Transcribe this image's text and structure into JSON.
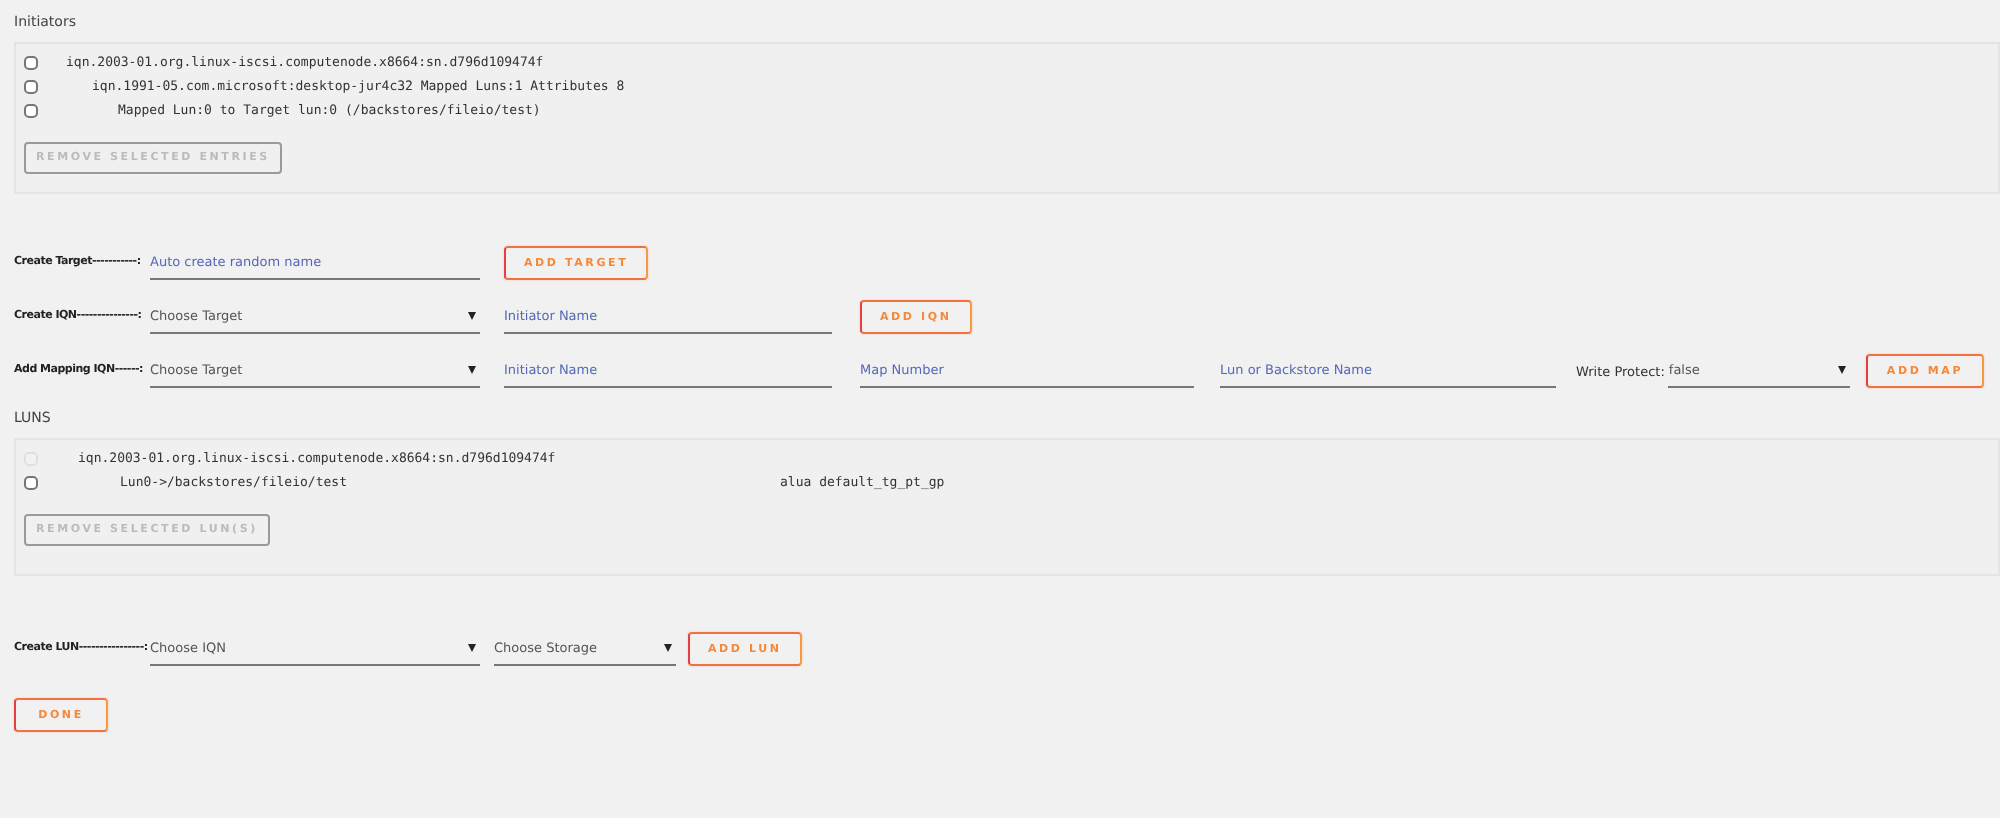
{
  "initiators": {
    "title": "Initiators",
    "items": [
      {
        "text": "iqn.2003-01.org.linux-iscsi.computenode.x8664:sn.d796d109474f",
        "checked": false,
        "disabled": false,
        "children": [
          {
            "text": "iqn.1991-05.com.microsoft:desktop-jur4c32 Mapped Luns:1 Attributes 8",
            "checked": false,
            "disabled": false,
            "children": [
              {
                "text": "Mapped Lun:0 to Target lun:0 (/backstores/fileio/test)",
                "checked": false,
                "disabled": false
              }
            ]
          }
        ]
      }
    ],
    "button": {
      "label": "REMOVE SELECTED ENTRIES",
      "disabled": true
    }
  },
  "forms": [
    {
      "label": "Create Target-----------:",
      "fields": [
        {
          "kind": "input",
          "placeholder": "Auto create random name"
        }
      ],
      "button": {
        "label": "ADD TARGET",
        "disabled": false
      }
    },
    {
      "label": "Create IQN---------------:",
      "fields": [
        {
          "kind": "select",
          "value": "Choose Target"
        },
        {
          "kind": "input",
          "placeholder": "Initiator Name"
        }
      ],
      "button": {
        "label": "ADD IQN",
        "disabled": false
      }
    },
    {
      "label": "Add Mapping IQN------:",
      "fields": [
        {
          "kind": "select",
          "value": "Choose Target"
        },
        {
          "kind": "input",
          "placeholder": "Initiator Name"
        },
        {
          "kind": "input",
          "placeholder": "Map Number"
        },
        {
          "kind": "input",
          "placeholder": "Lun or Backstore Name"
        },
        {
          "kind": "label",
          "text": "Write Protect:"
        },
        {
          "kind": "select",
          "value": "false"
        }
      ],
      "button": {
        "label": "ADD MAP",
        "disabled": false
      }
    }
  ],
  "luns": {
    "title": "LUNS",
    "items": [
      {
        "text": "iqn.2003-01.org.linux-iscsi.computenode.x8664:sn.d796d109474f",
        "checked": false,
        "disabled": true,
        "children": [
          {
            "text": "Lun0->/backstores/fileio/test",
            "extra": "alua default_tg_pt_gp",
            "checked": false,
            "disabled": false
          }
        ]
      }
    ],
    "button": {
      "label": "REMOVE SELECTED LUN(S)",
      "disabled": true
    }
  },
  "lun_form": {
    "label": "Create LUN----------------:",
    "fields": [
      {
        "kind": "select",
        "value": "Choose IQN"
      },
      {
        "kind": "select",
        "value": "Choose Storage"
      }
    ],
    "button": {
      "label": "ADD LUN",
      "disabled": false
    }
  },
  "done_button": {
    "label": "DONE",
    "disabled": false
  }
}
